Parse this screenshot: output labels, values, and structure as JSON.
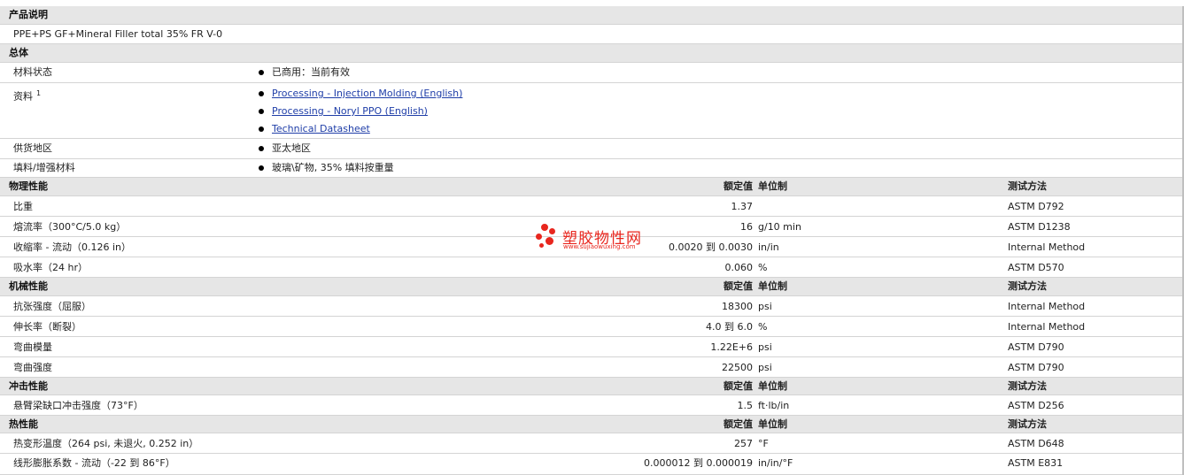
{
  "product_section": {
    "header": "产品说明",
    "description": "PPE+PS GF+Mineral Filler total 35% FR V-0"
  },
  "general": {
    "header": "总体",
    "rows": [
      {
        "label": "材料状态",
        "items": [
          {
            "text": "已商用：当前有效",
            "link": false
          }
        ]
      },
      {
        "label": "资料",
        "sup": "1",
        "items": [
          {
            "text": "Processing - Injection Molding (English)",
            "link": true
          },
          {
            "text": "Processing - Noryl PPO (English)",
            "link": true
          },
          {
            "text": "Technical Datasheet",
            "link": true
          }
        ]
      },
      {
        "label": "供货地区",
        "items": [
          {
            "text": "亚太地区",
            "link": false
          }
        ]
      },
      {
        "label": "填料/增强材料",
        "items": [
          {
            "text": "玻璃\\矿物, 35% 填料按重量",
            "link": false
          }
        ]
      }
    ]
  },
  "column_headers": {
    "value": "额定值",
    "unit": "单位制",
    "test": "测试方法"
  },
  "sections": [
    {
      "header": "物理性能",
      "rows": [
        {
          "label": "比重",
          "value": "1.37",
          "unit": "",
          "test": "ASTM D792"
        },
        {
          "label": "熔流率（300°C/5.0 kg）",
          "value": "16",
          "unit": "g/10 min",
          "test": "ASTM D1238"
        },
        {
          "label": "收缩率 - 流动（0.126 in）",
          "value": "0.0020 到  0.0030",
          "unit": "in/in",
          "test": "Internal Method"
        },
        {
          "label": "吸水率（24 hr）",
          "value": "0.060",
          "unit": "%",
          "test": "ASTM D570"
        }
      ]
    },
    {
      "header": "机械性能",
      "rows": [
        {
          "label": "抗张强度（屈服）",
          "value": "18300",
          "unit": "psi",
          "test": "Internal Method"
        },
        {
          "label": "伸长率（断裂）",
          "value": "4.0 到  6.0",
          "unit": "%",
          "test": "Internal Method"
        },
        {
          "label": "弯曲模量",
          "value": "1.22E+6",
          "unit": "psi",
          "test": "ASTM D790"
        },
        {
          "label": "弯曲强度",
          "value": "22500",
          "unit": "psi",
          "test": "ASTM D790"
        }
      ]
    },
    {
      "header": "冲击性能",
      "rows": [
        {
          "label": "悬臂梁缺口冲击强度（73°F）",
          "value": "1.5",
          "unit": "ft·lb/in",
          "test": "ASTM D256"
        }
      ]
    },
    {
      "header": "热性能",
      "rows": [
        {
          "label": "热变形温度（264 psi, 未退火, 0.252 in）",
          "value": "257",
          "unit": "°F",
          "test": "ASTM D648"
        },
        {
          "label": "线形膨胀系数 - 流动（-22 到  86°F）",
          "value": "0.000012 到  0.000019",
          "unit": "in/in/°F",
          "test": "ASTM E831"
        }
      ]
    }
  ],
  "watermark": {
    "title": "塑胶物性网",
    "url": "www.sujiaowuxing.com",
    "color": "#e8261e"
  }
}
